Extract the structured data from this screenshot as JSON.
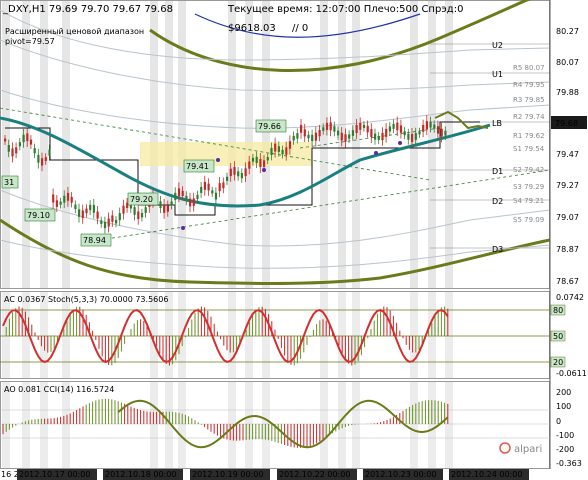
{
  "header": {
    "symbol_line": "_DXY,H1  79.69 79.70 79.67 79.68",
    "time_label": "Текущее время: 12:07:00 Плечо:500 Спрэд:0",
    "balance": "$9618.03",
    "balance_suffix": "// 0",
    "range_label": "Расширенный ценовой диапазон",
    "pivot_label": "pivot=79.57"
  },
  "price_axis": {
    "ticks": [
      "80.27",
      "80.07",
      "79.88",
      "79.68",
      "79.47",
      "79.27",
      "79.07",
      "78.87",
      "78.67"
    ],
    "current_price": "79.68"
  },
  "levels": {
    "left": [
      "U2",
      "U1",
      "LB",
      "D1",
      "D2",
      "D3"
    ],
    "right": [
      "R5 80.07",
      "R4 79.95",
      "R3 79.85",
      "R2 79.74",
      "R1 79.62",
      "S1 79.54",
      "S2 79.42",
      "S3 79.29",
      "S4 79.21",
      "S5 79.09"
    ]
  },
  "price_labels": [
    "79.66",
    "79.41",
    "79.20",
    "79.10",
    "78.94",
    "31"
  ],
  "indicators": {
    "panel1": {
      "label": "AC 0.0367  Stoch(5,3,3) 70.0000 73.5606",
      "ticks": [
        "0.0742",
        "80",
        "50",
        "20",
        "-0.0611"
      ]
    },
    "panel2": {
      "label": "AO 0.081  CCI(14) 116.5724",
      "ticks": [
        "200",
        "100",
        "0",
        "-100",
        "-200",
        "-0.363"
      ]
    }
  },
  "time_axis": [
    "16 2",
    "2012.10.17 00:00",
    "2012.10.18 00:00",
    "2012.10.19 00:00",
    "2012.10.22 00:00",
    "2012.10.23 00:00",
    "2012.10.24 00:00"
  ],
  "watermark": "alpari",
  "colors": {
    "candle_green": "#2e7d32",
    "candle_red": "#c62828",
    "ma_teal": "#1a7f7f",
    "olive": "#6b7a1a",
    "band_blue": "#2233aa"
  }
}
